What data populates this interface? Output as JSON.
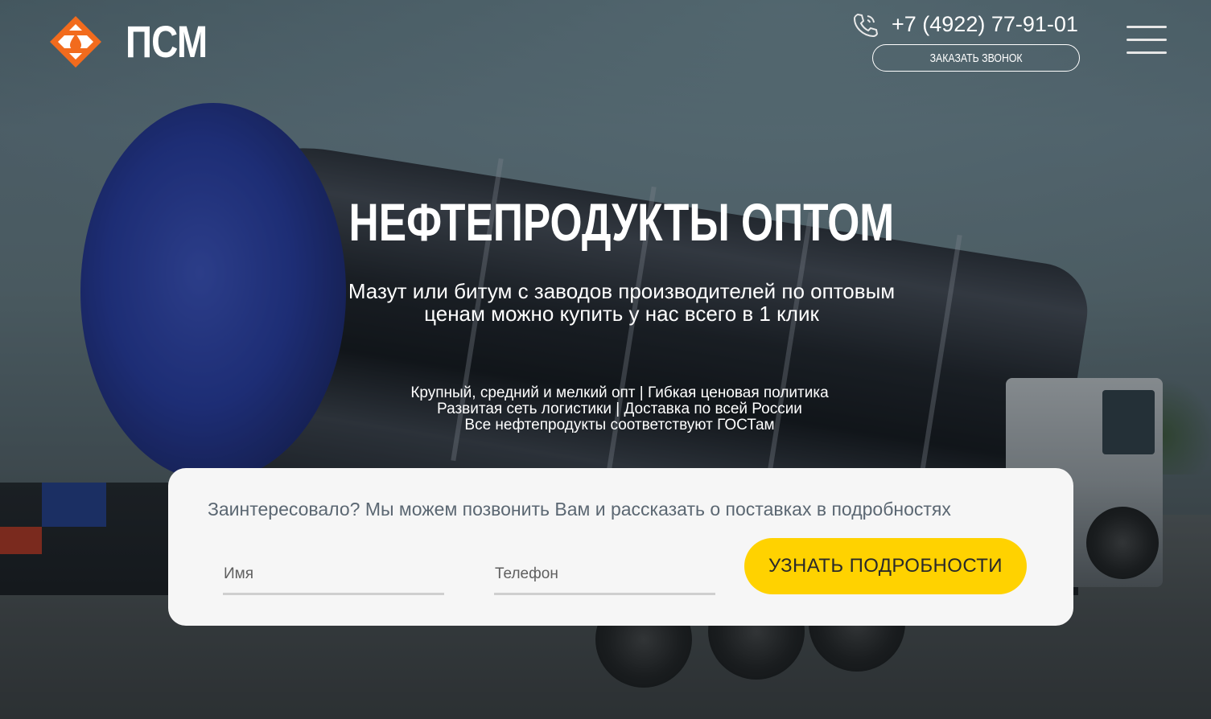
{
  "header": {
    "brand": "ПСМ",
    "logo_icon": "oil-drop-logo-icon",
    "phone_icon": "phone-call-icon",
    "phone": "+7 (4922) 77-91-01",
    "callback_button": "ЗАКАЗАТЬ ЗВОНОК",
    "menu_icon": "hamburger-menu-icon"
  },
  "hero": {
    "title": "НЕФТЕПРОДУКТЫ ОПТОМ",
    "subtitle_line1": "Мазут или битум с заводов производителей по оптовым",
    "subtitle_line2": "ценам можно купить у нас всего в 1 клик",
    "features": [
      "Крупный, средний и мелкий опт | Гибкая ценовая политика",
      "Развитая сеть логистики | Доставка по всей России",
      "Все нефтепродукты соответствуют ГОСТам"
    ]
  },
  "form": {
    "title": "Заинтересовало? Мы можем позвонить Вам и рассказать о поставках в подробностях",
    "name_placeholder": "Имя",
    "phone_placeholder": "Телефон",
    "submit": "УЗНАТЬ ПОДРОБНОСТИ"
  },
  "colors": {
    "accent": "#ffd200",
    "logo_orange": "#f26b1d",
    "card": "#f6f6f6"
  }
}
